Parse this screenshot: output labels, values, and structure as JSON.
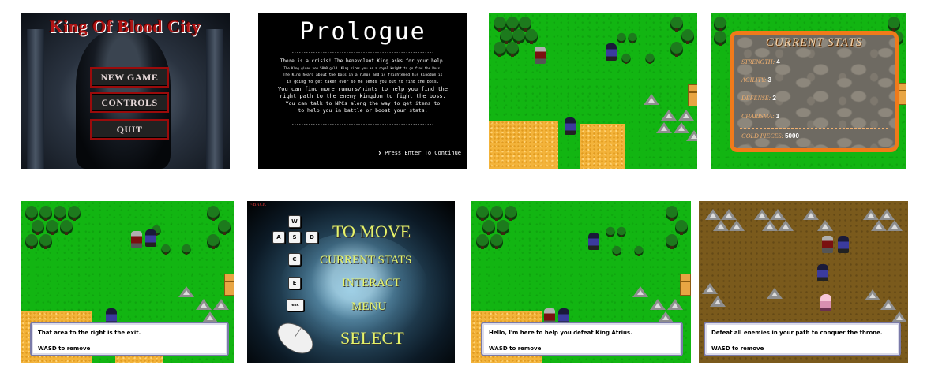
{
  "panel1": {
    "title": "King Of Blood City",
    "buttons": [
      "NEW GAME",
      "CONTROLS",
      "QUIT"
    ]
  },
  "panel2": {
    "title": "Prologue",
    "lines": [
      "There is a crisis! The benevolent King asks for your help.",
      "The King gives you 5000 gold. King hires you as a royal knight to go find the Boss.",
      "The King heard about the boss in a rumor and is frightened his kingdom is",
      "is going to get taken over so he sends you out to find the boss.",
      "You can find more rumors/hints to help you find the",
      "right path to the enemy kingdon to fight the boss.",
      "You can talk to NPCs along the way to get items to",
      "to help you in battle or boost your stats."
    ],
    "divider": "------------------------------------------------------------",
    "continue": "Press Enter To Continue"
  },
  "panel4": {
    "title": "CURRENT STATS",
    "stats": [
      {
        "label": "STRENGTH:",
        "value": "4"
      },
      {
        "label": "AGILITY:",
        "value": "3"
      },
      {
        "label": "DEFENSE:",
        "value": "2"
      },
      {
        "label": "CHARISMA:",
        "value": "1"
      }
    ],
    "gold_label": "GOLD PIECES:",
    "gold_value": "5000",
    "frame_color": "#f07a1a"
  },
  "panel5": {
    "dialog_line1": "That area to the right is the exit.",
    "dialog_line2": "WASD to remove"
  },
  "panel6": {
    "back": "<BACK",
    "keys": [
      "W",
      "A",
      "S",
      "D",
      "C",
      "E",
      "esc"
    ],
    "labels": {
      "move": "TO MOVE",
      "stats": "CURRENT STATS",
      "interact": "INTERACT",
      "menu": "MENU",
      "select": "SELECT"
    }
  },
  "panel7": {
    "dialog_line1": "Hello, I'm here to help you defeat King Atrius.",
    "dialog_line2": "WASD to remove"
  },
  "panel8": {
    "dialog_line1": "Defeat all enemies in your path to conquer the throne.",
    "dialog_line2": "WASD to remove"
  },
  "colors": {
    "grass": "#12b512",
    "dirt": "#7a5a1c",
    "sand": "#f3b33a",
    "control_text": "#e6f36a",
    "title_red": "#a01010"
  }
}
